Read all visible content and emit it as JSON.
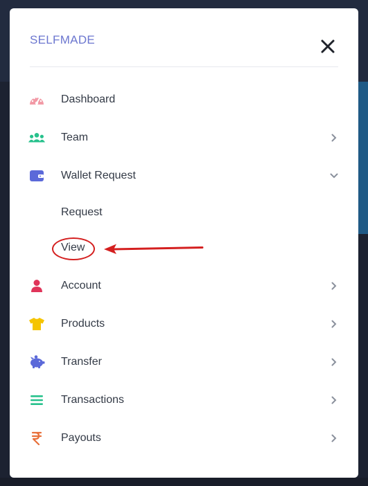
{
  "app": {
    "brand": "SELFMADE"
  },
  "menu": {
    "items": [
      {
        "label": "Dashboard",
        "icon": "dashboard-gauge-icon",
        "color": "#f29aa6",
        "chevron": "none"
      },
      {
        "label": "Team",
        "icon": "team-users-icon",
        "color": "#27c18c",
        "chevron": "right"
      },
      {
        "label": "Wallet Request",
        "icon": "wallet-icon",
        "color": "#5b69d9",
        "chevron": "down",
        "subitems": [
          {
            "label": "Request"
          },
          {
            "label": "View"
          }
        ]
      },
      {
        "label": "Account",
        "icon": "user-icon",
        "color": "#e0355a",
        "chevron": "right"
      },
      {
        "label": "Products",
        "icon": "tshirt-icon",
        "color": "#f5c400",
        "chevron": "right"
      },
      {
        "label": "Transfer",
        "icon": "piggy-bank-icon",
        "color": "#5b69d9",
        "chevron": "right"
      },
      {
        "label": "Transactions",
        "icon": "list-icon",
        "color": "#27c18c",
        "chevron": "right"
      },
      {
        "label": "Payouts",
        "icon": "rupee-icon",
        "color": "#e8703a",
        "chevron": "right"
      }
    ]
  },
  "annotation": {
    "highlight_color": "#d41f1f"
  }
}
